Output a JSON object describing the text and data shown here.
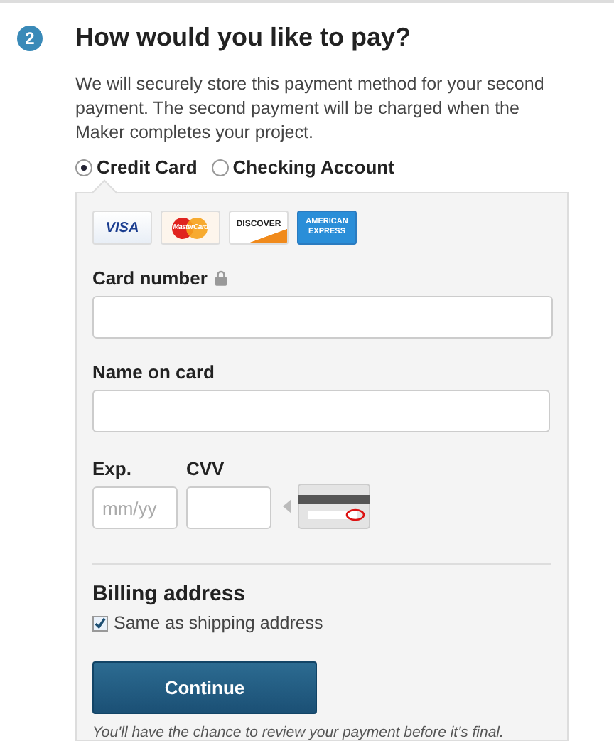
{
  "step": {
    "number": "2",
    "title": "How would you like to pay?"
  },
  "description": "We will securely store this payment method for your second payment. The second payment will be charged when the Maker completes your project.",
  "payment_methods": [
    {
      "label": "Credit Card",
      "selected": true
    },
    {
      "label": "Checking Account",
      "selected": false
    }
  ],
  "cards": [
    {
      "kind": "visa",
      "label": "VISA"
    },
    {
      "kind": "mastercard",
      "label": "MasterCard"
    },
    {
      "kind": "discover",
      "label": "DISCOVER"
    },
    {
      "kind": "amex",
      "label": "AMERICAN EXPRESS"
    }
  ],
  "card_number": {
    "label": "Card number"
  },
  "name_on_card": {
    "label": "Name on card"
  },
  "expiry": {
    "label": "Exp.",
    "placeholder": "mm/yy"
  },
  "cvv": {
    "label": "CVV"
  },
  "billing": {
    "title": "Billing address",
    "same_as_shipping": {
      "label": "Same as shipping address",
      "checked": true
    }
  },
  "button": "Continue",
  "note": "You'll have the chance to review your payment before it's final."
}
